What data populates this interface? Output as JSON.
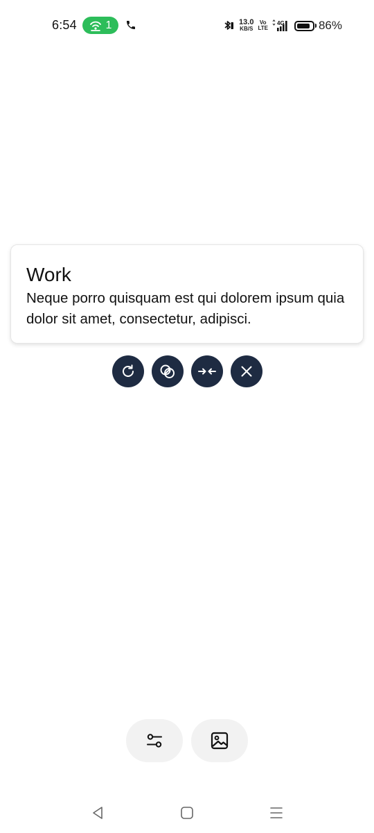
{
  "status_bar": {
    "time": "6:54",
    "hotspot_count": "1",
    "net_speed_value": "13.0",
    "net_speed_unit": "KB/S",
    "volte_top": "Vo",
    "volte_bottom": "LTE",
    "network_type": "4G",
    "battery_percent": "86%",
    "battery_level": 0.86,
    "hotspot_color": "#2dbd5a"
  },
  "note": {
    "title": "Work",
    "body": "Neque porro quisquam est qui dolorem ipsum quia dolor sit amet, consectetur, adipisci."
  },
  "actions": [
    {
      "icon": "refresh-icon"
    },
    {
      "icon": "overlap-icon"
    },
    {
      "icon": "merge-arrows-icon"
    },
    {
      "icon": "close-icon"
    }
  ],
  "bottom_buttons": [
    {
      "icon": "sliders-icon"
    },
    {
      "icon": "image-icon"
    }
  ],
  "nav": [
    {
      "icon": "back-triangle-icon"
    },
    {
      "icon": "home-square-icon"
    },
    {
      "icon": "recents-lines-icon"
    }
  ],
  "colors": {
    "action_button_bg": "#1e2b42",
    "pill_button_bg": "#f2f2f2"
  }
}
